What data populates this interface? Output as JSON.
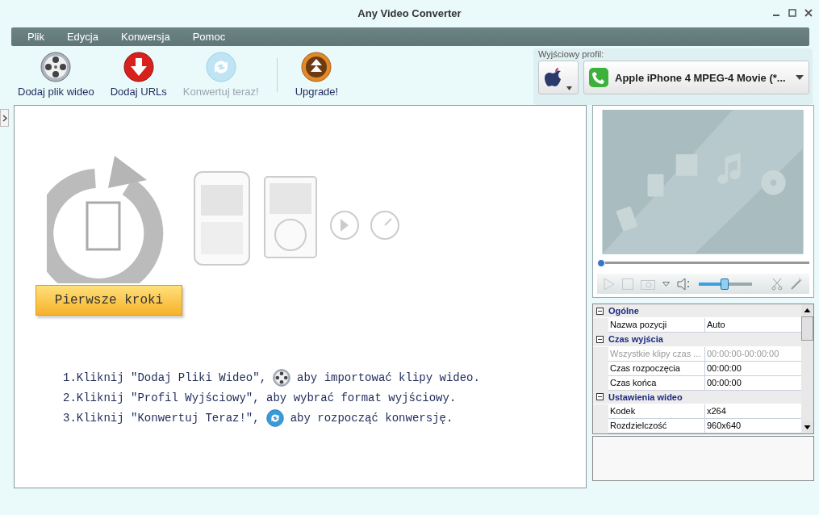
{
  "window": {
    "title": "Any Video Converter"
  },
  "menu": [
    {
      "label": "Plik"
    },
    {
      "label": "Edycja"
    },
    {
      "label": "Konwersja"
    },
    {
      "label": "Pomoc"
    }
  ],
  "toolbar": [
    {
      "kind": "add-video",
      "label": "Dodaj plik wideo",
      "disabled": false
    },
    {
      "kind": "add-url",
      "label": "Dodaj URLs",
      "disabled": false
    },
    {
      "kind": "convert",
      "label": "Konwertuj teraz!",
      "disabled": true
    },
    {
      "kind": "upgrade",
      "label": "Upgrade!",
      "disabled": false
    }
  ],
  "profile": {
    "label": "Wyjściowy profil:",
    "value": "Apple iPhone 4 MPEG-4 Movie (*..."
  },
  "getting_started": {
    "button": "Pierwsze kroki",
    "steps": [
      {
        "kind": "add-video",
        "number": "1.",
        "text": "Kliknij \"Dodaj Pliki Wideo\",",
        "text_after": "aby importować klipy wideo."
      },
      {
        "kind": "plain",
        "number": "2.",
        "text": "Kliknij \"Profil Wyjściowy\", aby wybrać format wyjściowy."
      },
      {
        "kind": "convert",
        "number": "3.",
        "text": "Kliknij \"Konwertuj Teraz!\",",
        "text_after": "aby rozpocząć konwersję."
      }
    ]
  },
  "player": {
    "seek": {
      "level": 0
    },
    "volume": {
      "level": 0.47
    }
  },
  "properties": [
    {
      "title": "Ogólne",
      "expanded": true,
      "rows": [
        {
          "name": "Nazwa pozycji",
          "value": "Auto",
          "disabled": false
        }
      ]
    },
    {
      "title": "Czas wyjścia",
      "expanded": true,
      "rows": [
        {
          "name": "Wszystkie klipy czas ...",
          "value": "00:00:00-00:00:00",
          "disabled": true
        },
        {
          "name": "Czas rozpoczęcia",
          "value": "00:00:00",
          "disabled": false
        },
        {
          "name": "Czas końca",
          "value": "00:00:00",
          "disabled": false
        }
      ]
    },
    {
      "title": "Ustawienia wideo",
      "expanded": true,
      "rows": [
        {
          "name": "Kodek",
          "value": "x264",
          "disabled": false
        },
        {
          "name": "Rozdzielczość",
          "value": "960x640",
          "disabled": false
        }
      ]
    }
  ]
}
